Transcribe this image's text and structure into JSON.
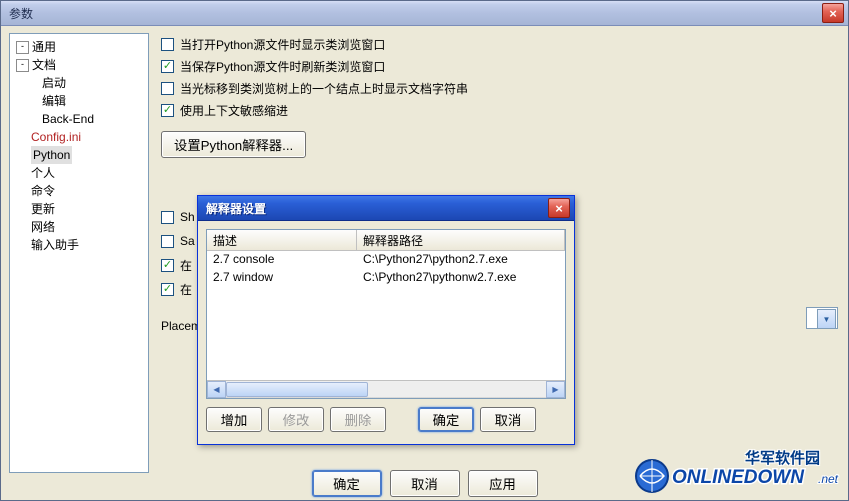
{
  "titlebar": {
    "title": "参数",
    "close": "×"
  },
  "tree": {
    "items": [
      {
        "label": "通用",
        "level": 0,
        "expander": "-"
      },
      {
        "label": "文档",
        "level": 0,
        "expander": "-"
      },
      {
        "label": "启动",
        "level": 1
      },
      {
        "label": "编辑",
        "level": 1
      },
      {
        "label": "Back-End",
        "level": 1
      },
      {
        "label": "Config.ini",
        "level": 0,
        "red": true
      },
      {
        "label": "Python",
        "level": 0,
        "sel": true
      },
      {
        "label": "个人",
        "level": 0
      },
      {
        "label": "命令",
        "level": 0
      },
      {
        "label": "更新",
        "level": 0
      },
      {
        "label": "网络",
        "level": 0
      },
      {
        "label": "输入助手",
        "level": 0
      }
    ]
  },
  "options": {
    "c1": {
      "checked": false,
      "label": "当打开Python源文件时显示类浏览窗口"
    },
    "c2": {
      "checked": true,
      "label": "当保存Python源文件时刷新类浏览窗口"
    },
    "c3": {
      "checked": false,
      "label": "当光标移到类浏览树上的一个结点上时显示文档字符串"
    },
    "c4": {
      "checked": true,
      "label": "使用上下文敏感缩进"
    },
    "set_btn": "设置Python解释器...",
    "partial": [
      {
        "checked": false,
        "label": "Sh"
      },
      {
        "checked": false,
        "label": "Sa"
      },
      {
        "checked": true,
        "label": "在"
      },
      {
        "checked": true,
        "label": "在"
      }
    ],
    "placement_label": "Placem"
  },
  "dialog": {
    "title": "解释器设置",
    "close": "×",
    "columns": {
      "desc": "描述",
      "path": "解释器路径"
    },
    "rows": [
      {
        "desc": "2.7 console",
        "path": "C:\\Python27\\python2.7.exe"
      },
      {
        "desc": "2.7 window",
        "path": "C:\\Python27\\pythonw2.7.exe"
      }
    ],
    "buttons": {
      "add": "增加",
      "edit": "修改",
      "del": "删除",
      "ok": "确定",
      "cancel": "取消"
    }
  },
  "bottom": {
    "ok": "确定",
    "cancel": "取消",
    "apply": "应用"
  },
  "watermark": {
    "cn": "华军软件园",
    "en": "ONLINEDOWN.net"
  }
}
